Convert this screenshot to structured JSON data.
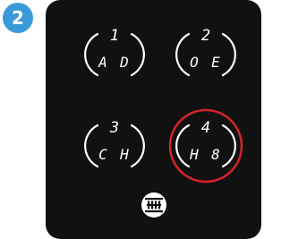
{
  "step_badge": {
    "label": "2",
    "color": "#3a9ad9"
  },
  "keypad": {
    "background_color": "#111111",
    "button_outline_color": "#ffffff",
    "highlight_color": "#d7232b",
    "highlighted_button": "button-4",
    "buttons": [
      {
        "number": "1",
        "letters_left": "A",
        "letters_right": "D"
      },
      {
        "number": "2",
        "letters_left": "O",
        "letters_right": "E"
      },
      {
        "number": "3",
        "letters_left": "C",
        "letters_right": "H"
      },
      {
        "number": "4",
        "letters_left": "H",
        "letters_right": "8"
      }
    ],
    "logo_icon": "fingerprint-logo-icon"
  }
}
